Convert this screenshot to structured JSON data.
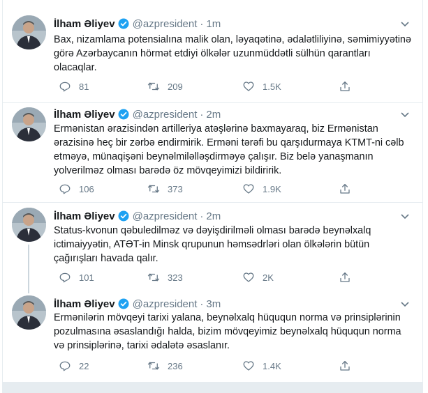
{
  "tweets": [
    {
      "name": "İlham Əliyev",
      "handle": "@azpresident",
      "separator": "·",
      "time": "1m",
      "text": "Bax, nizamlama potensialına malik olan, ləyaqətinə, ədalətliliyinə, səmimiyyətinə görə Azərbaycanın hörmət etdiyi ölkələr uzunmüddətli sülhün qarantları olacaqlar.",
      "replies": "81",
      "retweets": "209",
      "likes": "1.5K"
    },
    {
      "name": "İlham Əliyev",
      "handle": "@azpresident",
      "separator": "·",
      "time": "2m",
      "text": "Ermənistan ərazisindən artilleriya atəşlərinə baxmayaraq, biz Ermənistan ərazisinə heç bir zərbə endirmirik. Erməni tərəfi bu qarşıdurmaya KTMT-ni cəlb etməyə, münaqişəni beynəlmiləlləşdirməyə çalışır. Biz belə yanaşmanın yolverilməz olması barədə öz mövqeyimizi bildiririk.",
      "replies": "106",
      "retweets": "373",
      "likes": "1.9K"
    },
    {
      "name": "İlham Əliyev",
      "handle": "@azpresident",
      "separator": "·",
      "time": "2m",
      "text": "Status-kvonun qəbuledilməz və dəyişdirilməli olması barədə beynəlxalq ictimaiyyətin, ATƏT-in Minsk qrupunun həmsədrləri olan ölkələrin bütün çağırışları havada qalır.",
      "replies": "101",
      "retweets": "323",
      "likes": "2K"
    },
    {
      "name": "İlham Əliyev",
      "handle": "@azpresident",
      "separator": "·",
      "time": "3m",
      "text": "Ermənilərin mövqeyi tarixi yalana, beynəlxalq hüququn norma və prinsiplərinin pozulmasına əsaslandığı halda, bizim mövqeyimiz beynəlxalq hüququn norma və prinsiplərinə, tarixi ədalətə əsaslanır.",
      "replies": "22",
      "retweets": "236",
      "likes": "1.4K"
    }
  ],
  "colors": {
    "accent": "#1da1f2",
    "muted": "#657786",
    "border": "#e6ecf0",
    "text": "#14171a"
  },
  "icons": [
    "chevron-down-icon",
    "verified-badge-icon",
    "reply-icon",
    "retweet-icon",
    "like-icon",
    "share-icon"
  ]
}
